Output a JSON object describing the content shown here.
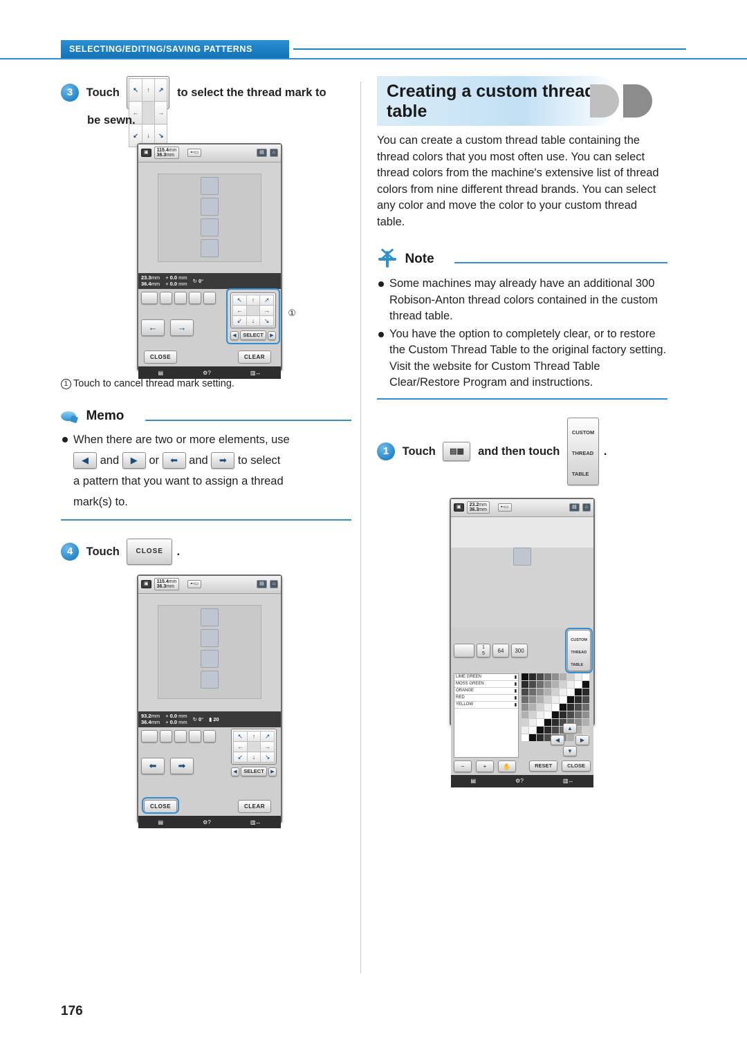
{
  "header": {
    "section_label": "SELECTING/EDITING/SAVING PATTERNS"
  },
  "page_number": "176",
  "left": {
    "step3": {
      "number": "3",
      "text_before": "Touch",
      "text_after": "to select the thread mark to",
      "text_line2": "be sewn."
    },
    "screen1": {
      "size_w": "115.4",
      "size_h": "36.3",
      "unit": "mm",
      "info": {
        "pos_w": "23.3",
        "pos_h": "36.4",
        "unit": "mm",
        "offset_x": "0.0",
        "offset_y": "0.0",
        "rotation": "0"
      },
      "arrow_pad": [
        "↖",
        "↑",
        "↗",
        "←",
        "",
        "→",
        "↙",
        "↓",
        "↘"
      ],
      "select_label": "SELECT",
      "close_label": "CLOSE",
      "clear_label": "CLEAR",
      "callout_num": "①"
    },
    "caption1": {
      "marker": "①",
      "text": "Touch to cancel thread mark setting."
    },
    "memo": {
      "title": "Memo",
      "line1_a": "When there are two or more elements, use",
      "line2_and": "and",
      "line2_or": "or",
      "line2_and2": "and",
      "line2_tail": "to select",
      "line3": "a pattern that you want to assign a thread",
      "line4": "mark(s) to."
    },
    "step4": {
      "number": "4",
      "text": "Touch",
      "button_label": "CLOSE",
      "period": "."
    },
    "screen2": {
      "size_w": "115.4",
      "size_h": "36.3",
      "unit": "mm",
      "info": {
        "pos_w": "93.2",
        "pos_h": "36.4",
        "unit": "mm",
        "offset_x": "0.0",
        "offset_y": "0.0",
        "rotation": "0",
        "count": "20"
      },
      "select_label": "SELECT",
      "close_label": "CLOSE",
      "clear_label": "CLEAR"
    }
  },
  "right": {
    "section_title_line1": "Creating a custom thread",
    "section_title_line2": "table",
    "intro": "You can create a custom thread table containing the thread colors that you most often use. You can select thread colors from the machine's extensive list of thread colors from nine different thread brands. You can select any color and move the color to your custom thread table.",
    "note": {
      "title": "Note",
      "items": [
        "Some machines may already have an additional 300 Robison-Anton thread colors contained in the custom thread table.",
        "You have the option to completely clear, or to restore the Custom Thread Table to the original factory setting. Visit the website for Custom Thread Table Clear/Restore Program and instructions."
      ]
    },
    "step1": {
      "number": "1",
      "text_before": "Touch",
      "text_middle": "and then touch",
      "button_label_l1": "CUSTOM",
      "button_label_l2": "THREAD",
      "button_label_l3": "TABLE",
      "period": "."
    },
    "screen3": {
      "size_w": "23.2",
      "size_h": "36.3",
      "unit": "mm",
      "page_top": "1",
      "page_bottom": "5",
      "count_64": "64",
      "count_300": "300",
      "custom_btn_l1": "CUSTOM",
      "custom_btn_l2": "THREAD",
      "custom_btn_l3": "TABLE",
      "thread_names": [
        "LIME GREEN",
        "MOSS GREEN",
        "ORANGE",
        "RED",
        "YELLOW"
      ],
      "reset_label": "RESET",
      "close_label": "CLOSE",
      "minus_label": "−",
      "plus_label": "+"
    }
  },
  "colors": {
    "accent": "#2f8fd0",
    "header_blue": "#1d7fc4",
    "text": "#231f20"
  }
}
